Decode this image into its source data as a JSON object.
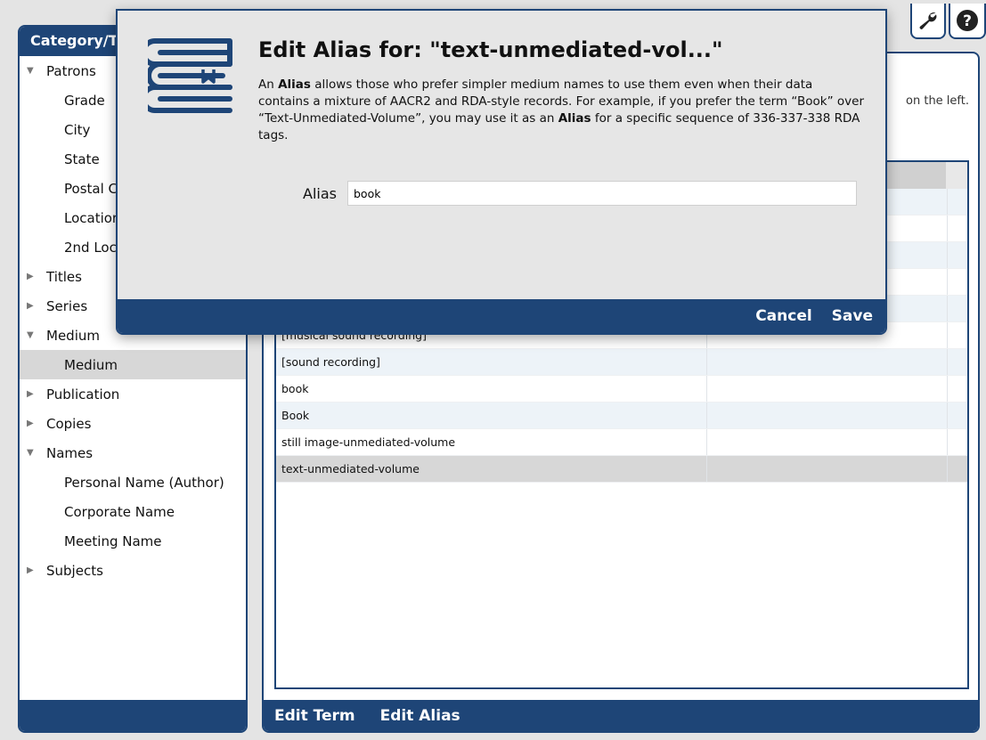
{
  "toolbar": {
    "settings_icon": "wrench-icon",
    "help_icon": "question-circle-icon"
  },
  "sidebar": {
    "header": "Category/T",
    "items": [
      {
        "label": "Patrons",
        "arrow": "▼",
        "level": 0
      },
      {
        "label": "Grade",
        "level": 1
      },
      {
        "label": "City",
        "level": 1
      },
      {
        "label": "State",
        "level": 1
      },
      {
        "label": "Postal C",
        "level": 1
      },
      {
        "label": "Locatior",
        "level": 1
      },
      {
        "label": "2nd Loc",
        "level": 1
      },
      {
        "label": "Titles",
        "arrow": "▶",
        "level": 0
      },
      {
        "label": "Series",
        "arrow": "▶",
        "level": 0
      },
      {
        "label": "Medium",
        "arrow": "▼",
        "level": 0
      },
      {
        "label": "Medium",
        "level": 1,
        "selected": true
      },
      {
        "label": "Publication",
        "arrow": "▶",
        "level": 0
      },
      {
        "label": "Copies",
        "arrow": "▶",
        "level": 0
      },
      {
        "label": "Names",
        "arrow": "▼",
        "level": 0
      },
      {
        "label": "Personal Name (Author)",
        "level": 1
      },
      {
        "label": "Corporate Name",
        "level": 1
      },
      {
        "label": "Meeting Name",
        "level": 1
      },
      {
        "label": "Subjects",
        "arrow": "▶",
        "level": 0
      }
    ]
  },
  "main": {
    "hint": "on the left.",
    "rows": [
      {
        "term": ""
      },
      {
        "term": ""
      },
      {
        "term": ""
      },
      {
        "term": ""
      },
      {
        "term": ""
      },
      {
        "term": "[musical sound recording]"
      },
      {
        "term": "[sound recording]"
      },
      {
        "term": "book"
      },
      {
        "term": "Book"
      },
      {
        "term": "still image-unmediated-volume"
      },
      {
        "term": "text-unmediated-volume",
        "selected": true
      }
    ],
    "footer": {
      "edit_term": "Edit Term",
      "edit_alias": "Edit Alias"
    }
  },
  "modal": {
    "title": "Edit Alias for: \"text-unmediated-vol...\"",
    "icon": "books-icon",
    "desc": {
      "p1": "An ",
      "b1": "Alias",
      "p2": " allows those who prefer simpler medium names to use them even when their data contains a mixture of AACR2 and RDA-style records. For example, if you prefer the term “Book” over “Text-Unmediated-Volume”, you may use it as an ",
      "b2": "Alias",
      "p3": " for a specific sequence of 336-337-338 RDA tags."
    },
    "alias_label": "Alias",
    "alias_value": "book",
    "cancel": "Cancel",
    "save": "Save"
  },
  "colors": {
    "accent": "#1e4577",
    "selected_row": "#d7d7d7",
    "stripe": "#edf3f8",
    "modal_bg": "#e6e6e6"
  }
}
